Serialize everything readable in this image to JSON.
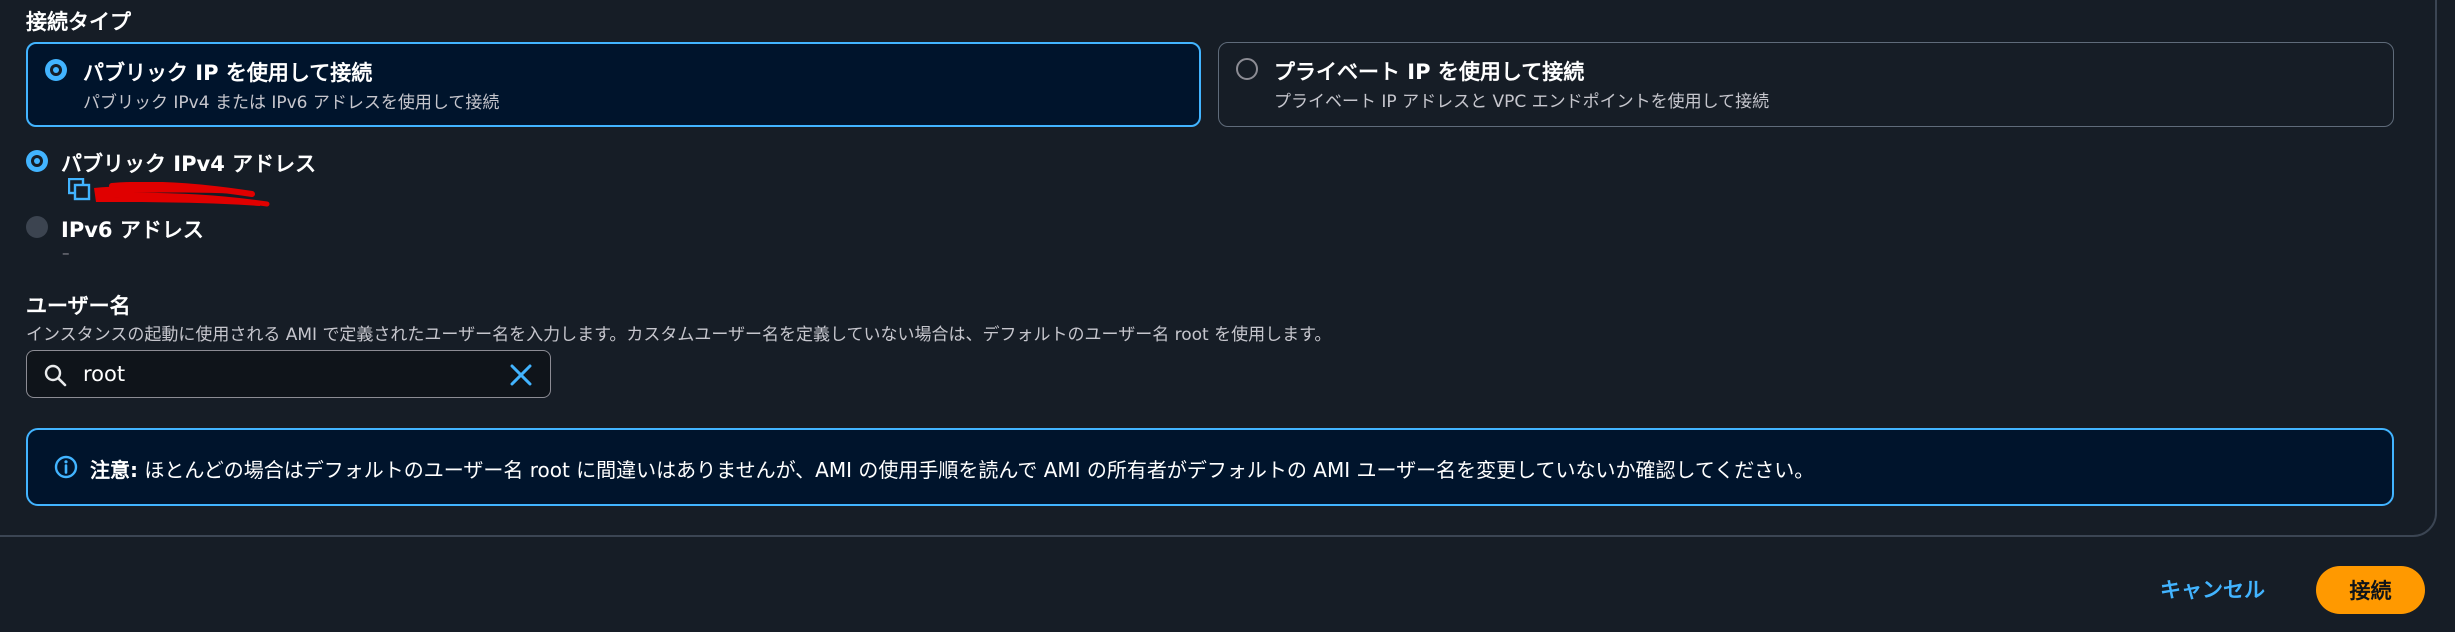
{
  "connection_type": {
    "label": "接続タイプ",
    "options": [
      {
        "title": "パブリック IP を使用して接続",
        "description": "パブリック IPv4 または IPv6 アドレスを使用して接続",
        "selected": true
      },
      {
        "title": "プライベート IP を使用して接続",
        "description": "プライベート IP アドレスと VPC エンドポイントを使用して接続",
        "selected": false
      }
    ]
  },
  "address": {
    "ipv4_label": "パブリック IPv4 アドレス",
    "ipv6_label": "IPv6 アドレス",
    "ipv6_value": "–"
  },
  "username": {
    "label": "ユーザー名",
    "description": "インスタンスの起動に使用される AMI で定義されたユーザー名を入力します。カスタムユーザー名を定義していない場合は、デフォルトのユーザー名 root を使用します。",
    "value": "root"
  },
  "alert": {
    "prefix": "注意:",
    "message": " ほとんどの場合はデフォルトのユーザー名 root に間違いはありませんが、AMI の使用手順を読んで AMI の所有者がデフォルトの AMI ユーザー名を変更していないか確認してください。"
  },
  "footer": {
    "cancel_label": "キャンセル",
    "connect_label": "接続"
  },
  "colors": {
    "accent": "#42b4ff",
    "primary_button": "#ff9900",
    "background": "#161d26",
    "redaction": "#e00000"
  }
}
